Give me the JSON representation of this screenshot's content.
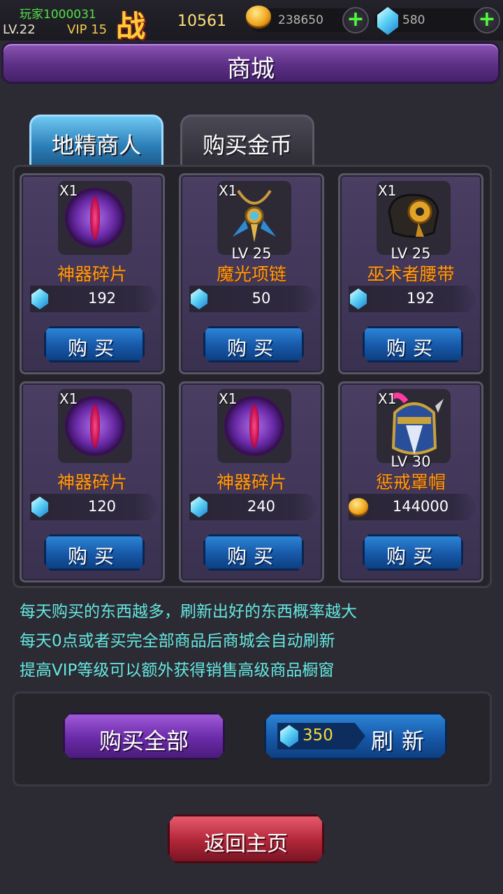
{
  "player": {
    "name": "玩家1000031",
    "level": "LV.22",
    "vip": "VIP 15",
    "power_glyph": "战",
    "power": "10561"
  },
  "currency": {
    "gold": "238650",
    "diamonds": "580",
    "gold_icon": "gold-coin-icon",
    "diamond_icon": "diamond-icon"
  },
  "title": "商城",
  "tabs": [
    {
      "label": "地精商人",
      "active": true
    },
    {
      "label": "购买金币",
      "active": false
    }
  ],
  "items": [
    {
      "qty": "X1",
      "level": "",
      "name": "神器碎片",
      "price": "192",
      "currency": "diamond",
      "buy_label": "购买",
      "icon": "artifact-shard-eye-icon"
    },
    {
      "qty": "X1",
      "level": "LV 25",
      "name": "魔光项链",
      "price": "50",
      "currency": "diamond",
      "buy_label": "购买",
      "icon": "necklace-icon"
    },
    {
      "qty": "X1",
      "level": "LV 25",
      "name": "巫术者腰带",
      "price": "192",
      "currency": "diamond",
      "buy_label": "购买",
      "icon": "belt-icon"
    },
    {
      "qty": "X1",
      "level": "",
      "name": "神器碎片",
      "price": "120",
      "currency": "diamond",
      "buy_label": "购买",
      "icon": "artifact-shard-eye-icon"
    },
    {
      "qty": "X1",
      "level": "",
      "name": "神器碎片",
      "price": "240",
      "currency": "diamond",
      "buy_label": "购买",
      "icon": "artifact-shard-eye-icon"
    },
    {
      "qty": "X1",
      "level": "LV 30",
      "name": "惩戒罩帽",
      "price": "144000",
      "currency": "gold",
      "buy_label": "购买",
      "icon": "helmet-icon"
    }
  ],
  "info": [
    "每天购买的东西越多，刷新出好的东西概率越大",
    "每天0点或者买完全部商品后商城会自动刷新",
    "提高VIP等级可以额外获得销售高级商品橱窗"
  ],
  "actions": {
    "buy_all": "购买全部",
    "refresh_cost": "350",
    "refresh": "刷新",
    "home": "返回主页"
  },
  "colors": {
    "item_name": "#ff9a1c",
    "info_text": "#64e8e0",
    "player_name": "#53e04b",
    "vip": "#f2c94c"
  }
}
